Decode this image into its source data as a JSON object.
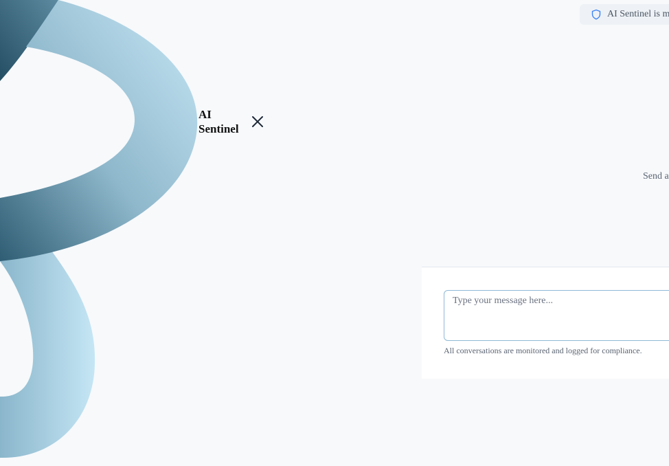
{
  "brand": {
    "title": "AI Sentinel"
  },
  "header": {
    "status_text": "AI Sentinel is m"
  },
  "chat": {
    "empty_hint": "Send a",
    "input_placeholder": "Type your message here...",
    "input_value": "",
    "compliance_note": "All conversations are monitored and logged for compliance."
  },
  "icons": {
    "close": "close-icon",
    "shield": "shield-icon"
  },
  "colors": {
    "background": "#f7f9fb",
    "ribbon_light": "#c3e4f3",
    "ribbon_dark": "#2f5f75",
    "accent": "#3b82f6",
    "input_border": "#8fb9d6"
  }
}
